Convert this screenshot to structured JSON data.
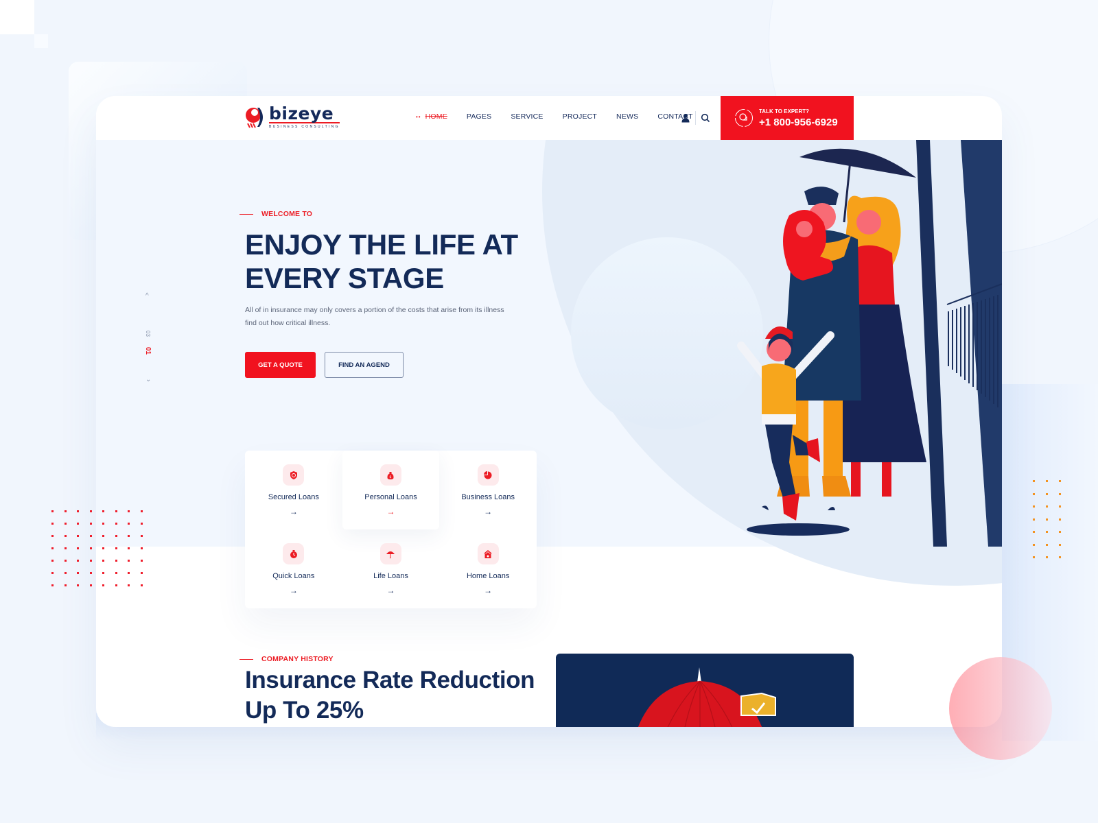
{
  "brand": {
    "name": "bizeye",
    "tagline": "BUSINESS CONSULTING",
    "accent_color": "#ec1c24",
    "navy_color": "#132a58"
  },
  "nav": {
    "items": [
      {
        "label": "HOME",
        "active": true
      },
      {
        "label": "PAGES",
        "active": false
      },
      {
        "label": "SERVICE",
        "active": false
      },
      {
        "label": "PROJECT",
        "active": false
      },
      {
        "label": "NEWS",
        "active": false
      },
      {
        "label": "CONTACT",
        "active": false
      }
    ],
    "icons": [
      "user-icon",
      "search-icon"
    ],
    "active_marker": "••"
  },
  "cta": {
    "label": "TALK TO EXPERT?",
    "phone": "+1 800-956-6929",
    "icon": "chat-bubble-icon"
  },
  "hero": {
    "eyebrow": "WELCOME TO",
    "title": "ENJOY THE LIFE AT EVERY STAGE",
    "description": "All of in insurance may only covers a portion of the costs that arise from its illness find out how critical illness.",
    "primary_button": "GET A QUOTE",
    "secondary_button": "FIND AN AGEND",
    "illustration": "family-under-umbrella-illustration"
  },
  "slider": {
    "current": "01",
    "total": "03",
    "up_icon": "^",
    "down_icon": "⌄"
  },
  "loans": {
    "arrow": "→",
    "items": [
      {
        "name": "Secured Loans",
        "icon": "shield-check-icon",
        "featured": false
      },
      {
        "name": "Personal Loans",
        "icon": "money-bag-icon",
        "featured": true
      },
      {
        "name": "Business Loans",
        "icon": "pie-chart-icon",
        "featured": false
      },
      {
        "name": "Quick Loans",
        "icon": "stopwatch-icon",
        "featured": false
      },
      {
        "name": "Life Loans",
        "icon": "umbrella-icon",
        "featured": false
      },
      {
        "name": "Home Loans",
        "icon": "house-icon",
        "featured": false
      }
    ]
  },
  "history": {
    "eyebrow": "COMPANY HISTORY",
    "title": "Insurance Rate Reduction Up To 25%",
    "image": "umbrella-shield-illustration"
  }
}
